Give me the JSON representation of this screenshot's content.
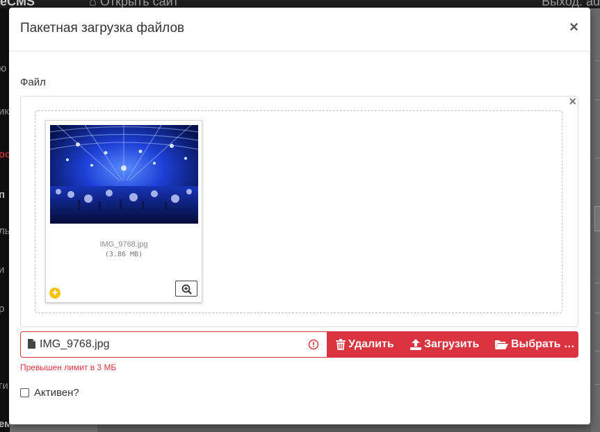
{
  "background": {
    "brand": "eCMS",
    "open_site": "Открыть сайт",
    "logout": "Выход: ad",
    "sidebar_fragments": [
      "ю",
      "ик",
      "ос",
      "п",
      "ль",
      "и",
      "р",
      "ги",
      "ема"
    ]
  },
  "modal": {
    "title": "Пакетная загрузка файлов",
    "close_glyph": "×"
  },
  "form": {
    "file_label": "Файл",
    "preview_clear_glyph": "×",
    "thumbnail": {
      "file_name": "IMG_9768.jpg",
      "file_size": "(3.86 MB)",
      "add_glyph": "+"
    },
    "caption": {
      "file_name": "IMG_9768.jpg"
    },
    "buttons": {
      "delete": "Удалить",
      "upload": "Загрузить",
      "browse": "Выбрать …"
    },
    "error_message": "Превышен лимит в 3 МБ",
    "active_label": "Активен?",
    "active_checked": false
  },
  "colors": {
    "danger": "#d9343f",
    "warning": "#f4c20d"
  }
}
